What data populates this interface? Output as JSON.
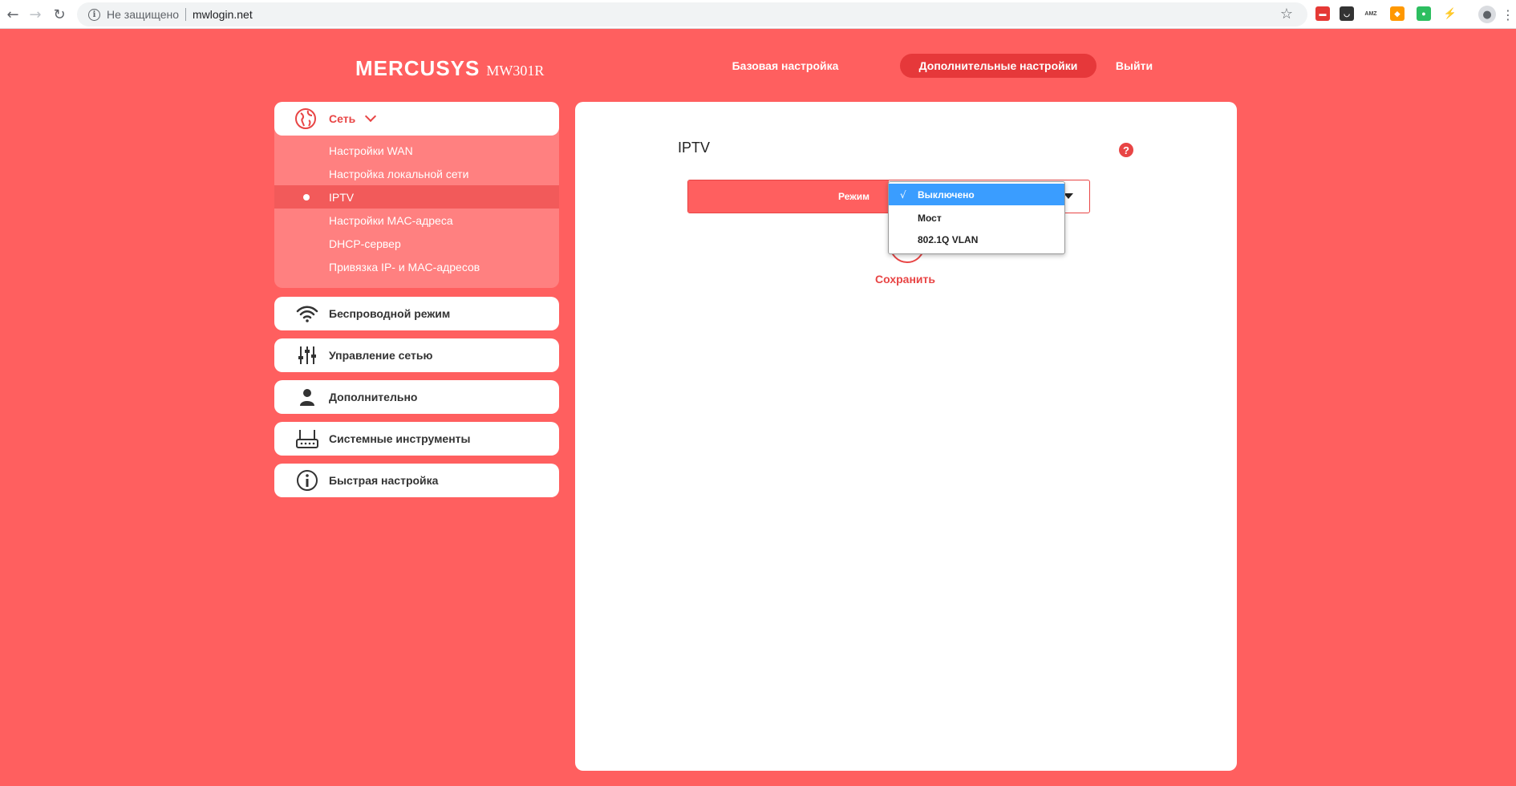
{
  "browser": {
    "security_text": "Не защищено",
    "url": "mwlogin.net",
    "extensions": [
      {
        "name": "ext-red-icon",
        "color": "#e53935",
        "glyph": "▬"
      },
      {
        "name": "pocket-icon",
        "color": "#333333",
        "glyph": "◡"
      },
      {
        "name": "amz-icon",
        "color": "#444444",
        "glyph": "AMZ"
      },
      {
        "name": "ext-orange-icon",
        "color": "#ff9800",
        "glyph": "◆"
      },
      {
        "name": "evernote-icon",
        "color": "#2dbe60",
        "glyph": "●"
      },
      {
        "name": "ext-bolt-icon",
        "color": "#9e9e9e",
        "glyph": "⚡"
      }
    ]
  },
  "header": {
    "logo": "MERCUSYS",
    "model": "MW301R",
    "nav": {
      "basic": "Базовая настройка",
      "advanced": "Дополнительные настройки",
      "logout": "Выйти"
    }
  },
  "sidebar": {
    "network": {
      "label": "Сеть",
      "items": [
        {
          "label": "Настройки WAN"
        },
        {
          "label": "Настройка локальной сети"
        },
        {
          "label": "IPTV"
        },
        {
          "label": "Настройки MAC-адреса"
        },
        {
          "label": "DHCP-сервер"
        },
        {
          "label": "Привязка IP- и MAC-адресов"
        }
      ],
      "active_index": 2
    },
    "sections": [
      {
        "label": "Беспроводной режим",
        "icon": "wifi-icon"
      },
      {
        "label": "Управление сетью",
        "icon": "sliders-icon"
      },
      {
        "label": "Дополнительно",
        "icon": "user-icon"
      },
      {
        "label": "Системные инструменты",
        "icon": "router-icon"
      },
      {
        "label": "Быстрая настройка",
        "icon": "info-icon"
      }
    ]
  },
  "main": {
    "title": "IPTV",
    "mode_label": "Режим",
    "dropdown": {
      "options": [
        "Выключено",
        "Мост",
        "802.1Q VLAN"
      ],
      "selected_index": 0,
      "check": "√"
    },
    "save_label": "Сохранить"
  },
  "colors": {
    "background": "#ff5f5f",
    "accent": "#e84545",
    "selected_option": "#3a9dff"
  }
}
